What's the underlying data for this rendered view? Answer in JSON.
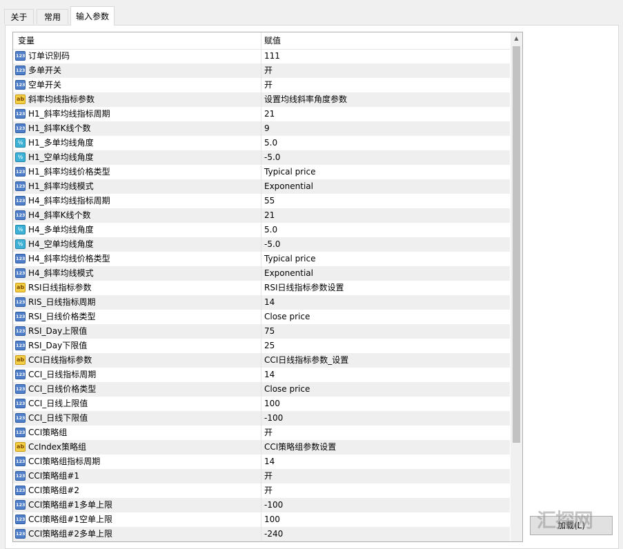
{
  "tabs": [
    {
      "label": "关于"
    },
    {
      "label": "常用"
    },
    {
      "label": "输入参数",
      "active": true
    }
  ],
  "grid": {
    "headers": {
      "variable": "变量",
      "value": "赋值"
    },
    "rows": [
      {
        "type": "int",
        "icon": "123",
        "name": "订单识别码",
        "value": "111"
      },
      {
        "type": "int",
        "icon": "123",
        "name": "多单开关",
        "value": "开"
      },
      {
        "type": "int",
        "icon": "123",
        "name": "空单开关",
        "value": "开"
      },
      {
        "type": "str",
        "icon": "ab",
        "name": "斜率均线指标参数",
        "value": "设置均线斜率角度参数"
      },
      {
        "type": "int",
        "icon": "123",
        "name": "H1_斜率均线指标周期",
        "value": "21"
      },
      {
        "type": "int",
        "icon": "123",
        "name": "H1_斜率K线个数",
        "value": "9"
      },
      {
        "type": "dbl",
        "icon": "½",
        "name": "H1_多单均线角度",
        "value": "5.0"
      },
      {
        "type": "dbl",
        "icon": "½",
        "name": "H1_空单均线角度",
        "value": "-5.0"
      },
      {
        "type": "int",
        "icon": "123",
        "name": "H1_斜率均线价格类型",
        "value": "Typical price"
      },
      {
        "type": "int",
        "icon": "123",
        "name": "H1_斜率均线模式",
        "value": "Exponential"
      },
      {
        "type": "int",
        "icon": "123",
        "name": "H4_斜率均线指标周期",
        "value": "55"
      },
      {
        "type": "int",
        "icon": "123",
        "name": "H4_斜率K线个数",
        "value": "21"
      },
      {
        "type": "dbl",
        "icon": "½",
        "name": "H4_多单均线角度",
        "value": "5.0"
      },
      {
        "type": "dbl",
        "icon": "½",
        "name": "H4_空单均线角度",
        "value": "-5.0"
      },
      {
        "type": "int",
        "icon": "123",
        "name": "H4_斜率均线价格类型",
        "value": "Typical price"
      },
      {
        "type": "int",
        "icon": "123",
        "name": "H4_斜率均线模式",
        "value": "Exponential"
      },
      {
        "type": "str",
        "icon": "ab",
        "name": "RSI日线指标参数",
        "value": "RSI日线指标参数设置"
      },
      {
        "type": "int",
        "icon": "123",
        "name": "RIS_日线指标周期",
        "value": "14"
      },
      {
        "type": "int",
        "icon": "123",
        "name": "RSI_日线价格类型",
        "value": "Close price"
      },
      {
        "type": "int",
        "icon": "123",
        "name": "RSI_Day上限值",
        "value": "75"
      },
      {
        "type": "int",
        "icon": "123",
        "name": "RSI_Day下限值",
        "value": "25"
      },
      {
        "type": "str",
        "icon": "ab",
        "name": "CCI日线指标参数",
        "value": "CCI日线指标参数_设置"
      },
      {
        "type": "int",
        "icon": "123",
        "name": "CCI_日线指标周期",
        "value": "14"
      },
      {
        "type": "int",
        "icon": "123",
        "name": "CCI_日线价格类型",
        "value": "Close price"
      },
      {
        "type": "int",
        "icon": "123",
        "name": "CCI_日线上限值",
        "value": "100"
      },
      {
        "type": "int",
        "icon": "123",
        "name": "CCI_日线下限值",
        "value": "-100"
      },
      {
        "type": "int",
        "icon": "123",
        "name": "CCI策略组",
        "value": "开"
      },
      {
        "type": "str",
        "icon": "ab",
        "name": "CcIndex策略组",
        "value": "CCI策略组参数设置"
      },
      {
        "type": "int",
        "icon": "123",
        "name": "CCI策略组指标周期",
        "value": "14"
      },
      {
        "type": "int",
        "icon": "123",
        "name": "CCI策略组#1",
        "value": "开"
      },
      {
        "type": "int",
        "icon": "123",
        "name": "CCI策略组#2",
        "value": "开"
      },
      {
        "type": "int",
        "icon": "123",
        "name": "CCI策略组#1多单上限",
        "value": "-100"
      },
      {
        "type": "int",
        "icon": "123",
        "name": "CCI策略组#1空单上限",
        "value": "100"
      },
      {
        "type": "int",
        "icon": "123",
        "name": "CCI策略组#2多单上限",
        "value": "-240"
      }
    ]
  },
  "scrollbar": {
    "up_arrow": "▲"
  },
  "load_button": {
    "label": "加载(L)"
  },
  "watermark": {
    "text": "汇探网"
  }
}
